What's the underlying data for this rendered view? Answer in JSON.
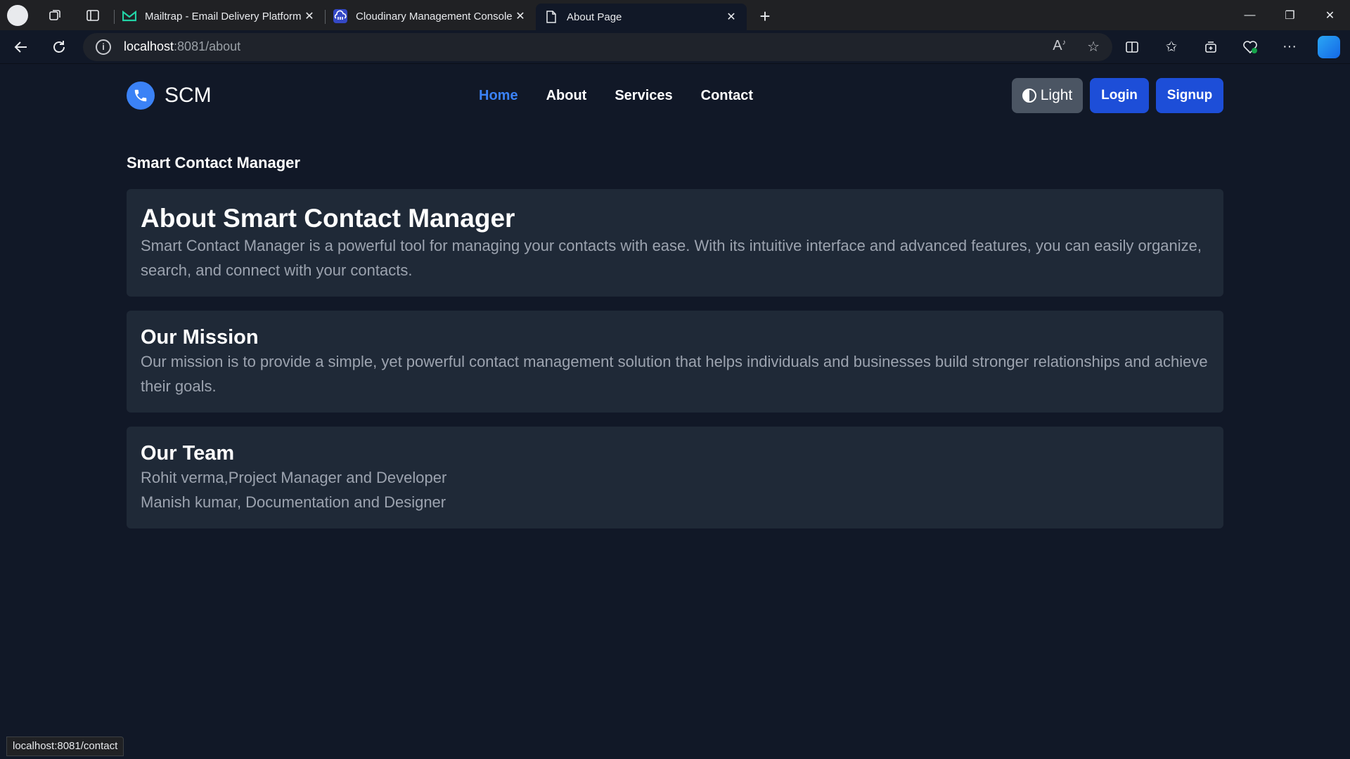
{
  "browser": {
    "tabs": [
      {
        "title": "Mailtrap - Email Delivery Platform",
        "icon": "mailtrap-icon"
      },
      {
        "title": "Cloudinary Management Console",
        "icon": "cloudinary-icon"
      },
      {
        "title": "About Page",
        "icon": "page-icon"
      }
    ],
    "url_host": "localhost",
    "url_path": ":8081/about",
    "status_text": "localhost:8081/contact"
  },
  "navbar": {
    "brand": "SCM",
    "links": [
      "Home",
      "About",
      "Services",
      "Contact"
    ],
    "theme_label": "Light",
    "login_label": "Login",
    "signup_label": "Signup"
  },
  "main": {
    "page_heading": "Smart Contact Manager",
    "about": {
      "title": "About Smart Contact Manager",
      "body": "Smart Contact Manager is a powerful tool for managing your contacts with ease. With its intuitive interface and advanced features, you can easily organize, search, and connect with your contacts."
    },
    "mission": {
      "title": "Our Mission",
      "body": "Our mission is to provide a simple, yet powerful contact management solution that helps individuals and businesses build stronger relationships and achieve their goals."
    },
    "team": {
      "title": "Our Team",
      "members": [
        "Rohit verma,Project Manager and Developer",
        "Manish kumar, Documentation and Designer"
      ]
    }
  },
  "colors": {
    "page_bg": "#111827",
    "card_bg": "#1f2937",
    "accent": "#3b82f6",
    "button": "#1d4ed8"
  }
}
